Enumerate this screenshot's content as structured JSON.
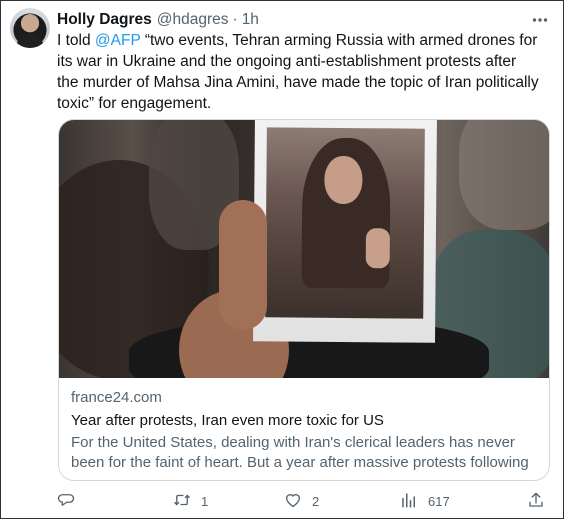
{
  "tweet": {
    "author": {
      "display_name": "Holly Dagres",
      "handle": "@hdagres",
      "separator": "·",
      "time": "1h"
    },
    "text_prefix": "I told ",
    "mention": "@AFP",
    "text_body": " “two events, Tehran arming Russia with armed drones for its war in Ukraine and the ongoing anti-establishment protests after the murder of Mahsa Jina Amini, have made the topic of Iran politically toxic” for engagement.",
    "card": {
      "domain": "france24.com",
      "title": "Year after protests, Iran even more toxic for US",
      "description": "For the United States, dealing with Iran's clerical leaders has never been for the faint of heart. But a year after massive protests following ..."
    },
    "actions": {
      "reply_count": "",
      "retweet_count": "1",
      "like_count": "2",
      "views_count": "617"
    }
  },
  "colors": {
    "text": "#0f1419",
    "muted": "#536471",
    "link": "#1d9bf0",
    "border": "#cfd9de"
  }
}
